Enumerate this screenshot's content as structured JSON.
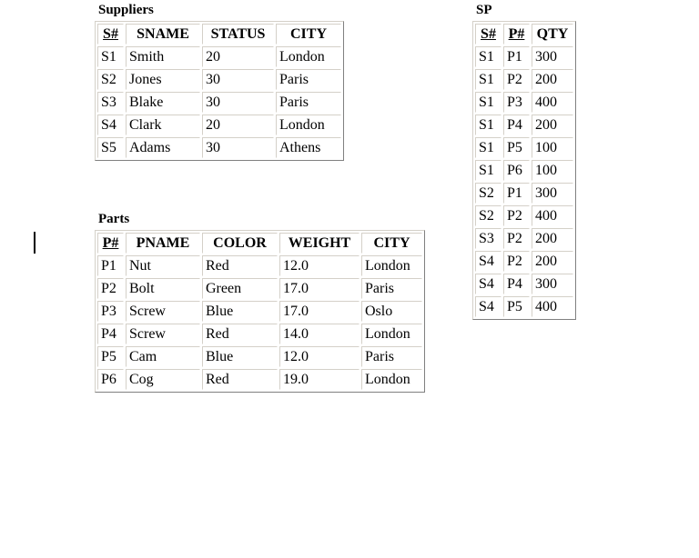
{
  "page": {
    "background_color": "#ffffff",
    "text_color": "#000000",
    "border_color": "#808080",
    "caret_color": "#000000"
  },
  "caret": {
    "label": "text-cursor"
  },
  "tables": [
    {
      "id": "suppliers",
      "title": "Suppliers",
      "columns": [
        {
          "label": "S#",
          "primary_key": true
        },
        {
          "label": "SNAME",
          "primary_key": false
        },
        {
          "label": "STATUS",
          "primary_key": false
        },
        {
          "label": "CITY",
          "primary_key": false
        }
      ],
      "rows": [
        [
          "S1",
          "Smith",
          "20",
          "London"
        ],
        [
          "S2",
          "Jones",
          "30",
          "Paris"
        ],
        [
          "S3",
          "Blake",
          "30",
          "Paris"
        ],
        [
          "S4",
          "Clark",
          "20",
          "London"
        ],
        [
          "S5",
          "Adams",
          "30",
          "Athens"
        ]
      ]
    },
    {
      "id": "parts",
      "title": "Parts",
      "columns": [
        {
          "label": "P#",
          "primary_key": true
        },
        {
          "label": "PNAME",
          "primary_key": false
        },
        {
          "label": "COLOR",
          "primary_key": false
        },
        {
          "label": "WEIGHT",
          "primary_key": false
        },
        {
          "label": "CITY",
          "primary_key": false
        }
      ],
      "rows": [
        [
          "P1",
          "Nut",
          "Red",
          "12.0",
          "London"
        ],
        [
          "P2",
          "Bolt",
          "Green",
          "17.0",
          "Paris"
        ],
        [
          "P3",
          "Screw",
          "Blue",
          "17.0",
          "Oslo"
        ],
        [
          "P4",
          "Screw",
          "Red",
          "14.0",
          "London"
        ],
        [
          "P5",
          "Cam",
          "Blue",
          "12.0",
          "Paris"
        ],
        [
          "P6",
          "Cog",
          "Red",
          "19.0",
          "London"
        ]
      ]
    },
    {
      "id": "sp",
      "title": "SP",
      "columns": [
        {
          "label": "S#",
          "primary_key": true
        },
        {
          "label": "P#",
          "primary_key": true
        },
        {
          "label": "QTY",
          "primary_key": false
        }
      ],
      "rows": [
        [
          "S1",
          "P1",
          "300"
        ],
        [
          "S1",
          "P2",
          "200"
        ],
        [
          "S1",
          "P3",
          "400"
        ],
        [
          "S1",
          "P4",
          "200"
        ],
        [
          "S1",
          "P5",
          "100"
        ],
        [
          "S1",
          "P6",
          "100"
        ],
        [
          "S2",
          "P1",
          "300"
        ],
        [
          "S2",
          "P2",
          "400"
        ],
        [
          "S3",
          "P2",
          "200"
        ],
        [
          "S4",
          "P2",
          "200"
        ],
        [
          "S4",
          "P4",
          "300"
        ],
        [
          "S4",
          "P5",
          "400"
        ]
      ]
    }
  ]
}
